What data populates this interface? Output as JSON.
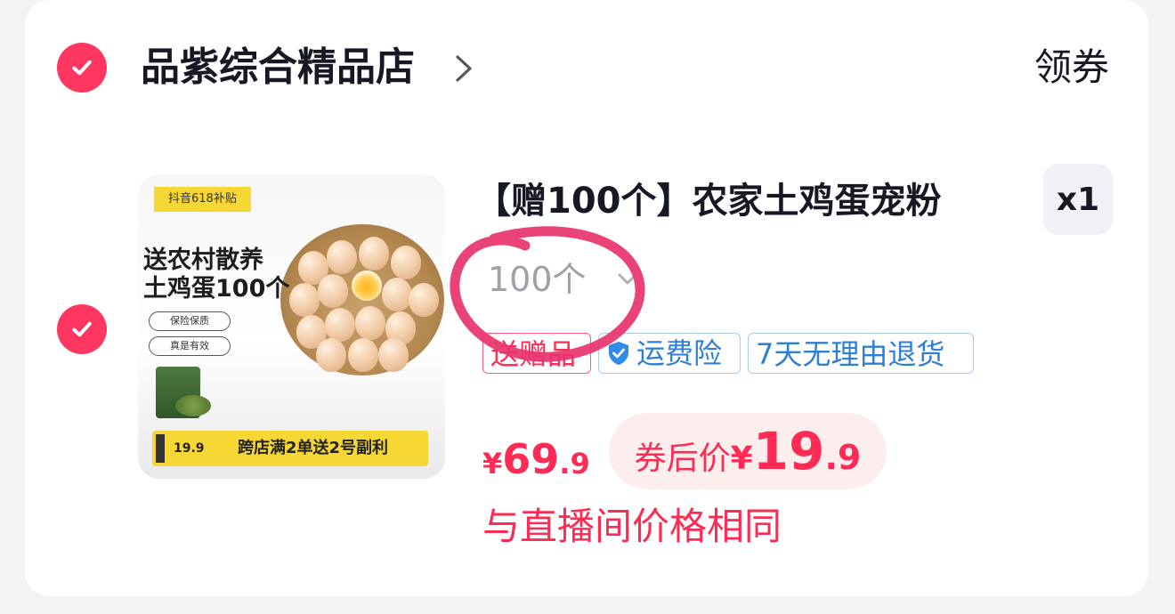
{
  "shop": {
    "name": "品紫综合精品店",
    "coupon_label": "领券"
  },
  "item": {
    "title": "【赠100个】农家土鸡蛋宠粉",
    "quantity": "x1",
    "variant": "100个",
    "badges": {
      "gift": "送赠品",
      "shipping_insurance": "运费险",
      "return_policy": "7天无理由退货"
    },
    "price_original": {
      "currency": "¥",
      "integer": "69",
      "decimal": ".9"
    },
    "coupon_price": {
      "label": "券后价",
      "currency": "¥",
      "integer": "19",
      "decimal": ".9"
    },
    "live_note": "与直播间价格相同",
    "image": {
      "tag": "抖音618补贴",
      "headline_1": "送农村散养",
      "headline_2": "土鸡蛋100个",
      "pill_1": "保险保质",
      "pill_2": "真是有效",
      "promo_price": "19.9",
      "promo_text": "跨店满2单送2号副利"
    }
  },
  "colors": {
    "accent": "#fe2c55",
    "check": "#fe3660",
    "service_blue": "#2e7fd6",
    "coupon_bg": "#fdeeee",
    "annotation": "#e8336c"
  },
  "icons": [
    "check-icon",
    "chevron-right-icon",
    "chevron-down-icon",
    "shield-check-icon"
  ]
}
